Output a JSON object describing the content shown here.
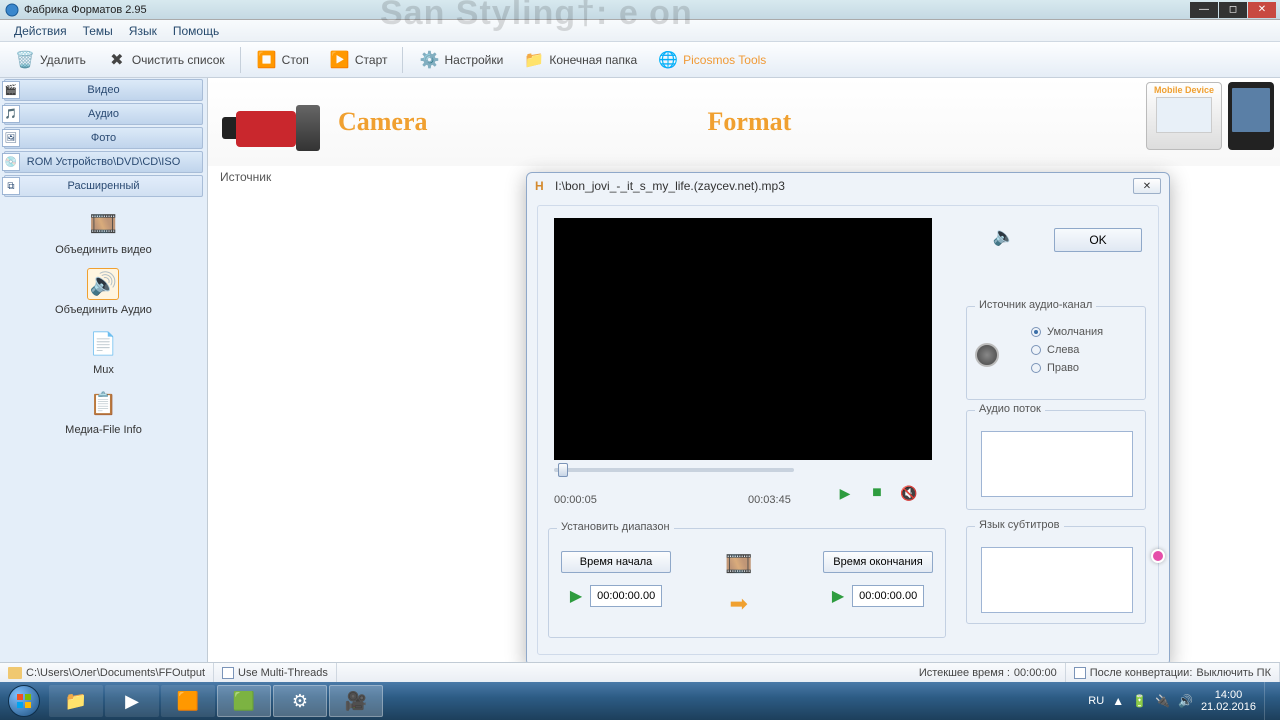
{
  "titlebar": {
    "title": "Фабрика Форматов 2.95"
  },
  "menubar": {
    "actions": "Действия",
    "themes": "Темы",
    "language": "Язык",
    "help": "Помощь"
  },
  "toolbar": {
    "delete": "Удалить",
    "clear": "Очистить список",
    "stop": "Стоп",
    "start": "Старт",
    "settings": "Настройки",
    "outfolder": "Конечная папка",
    "picosmos": "Picosmos Tools"
  },
  "sidebar": {
    "cats": {
      "video": "Видео",
      "audio": "Аудио",
      "photo": "Фото",
      "rom": "ROM Устройство\\DVD\\CD\\ISO",
      "advanced": "Расширенный"
    },
    "tools": {
      "merge_video": "Объединить видео",
      "merge_audio": "Объединить Аудио",
      "mux": "Mux",
      "media_info": "Медиа-File Info"
    }
  },
  "main": {
    "section_title": "Источник",
    "brand_camera": "Camera",
    "brand_format": "Format",
    "mobile": "Mobile Device"
  },
  "dialog": {
    "filename": "I:\\bon_jovi_-_it_s_my_life.(zaycev.net).mp3",
    "ok": "OK",
    "time_current": "00:00:05",
    "time_total": "00:03:45",
    "range_title": "Установить диапазон",
    "start_label": "Время начала",
    "end_label": "Время окончания",
    "start_val": "00:00:00.00",
    "end_val": "00:00:00.00",
    "audio_src_title": "Источник аудио-канал",
    "audio_src": {
      "default": "Умолчания",
      "left": "Слева",
      "right": "Право"
    },
    "audio_stream_title": "Аудио поток",
    "sublang_title": "Язык субтитров"
  },
  "statusbar": {
    "output_path": "C:\\Users\\Олег\\Documents\\FFOutput",
    "multithread": "Use Multi-Threads",
    "elapsed_label": "Истекшее время : ",
    "elapsed_val": "00:00:00",
    "after_label": "После конвертации: ",
    "after_val": "Выключить ПК"
  },
  "taskbar": {
    "lang": "RU",
    "time": "14:00",
    "date": "21.02.2016"
  }
}
